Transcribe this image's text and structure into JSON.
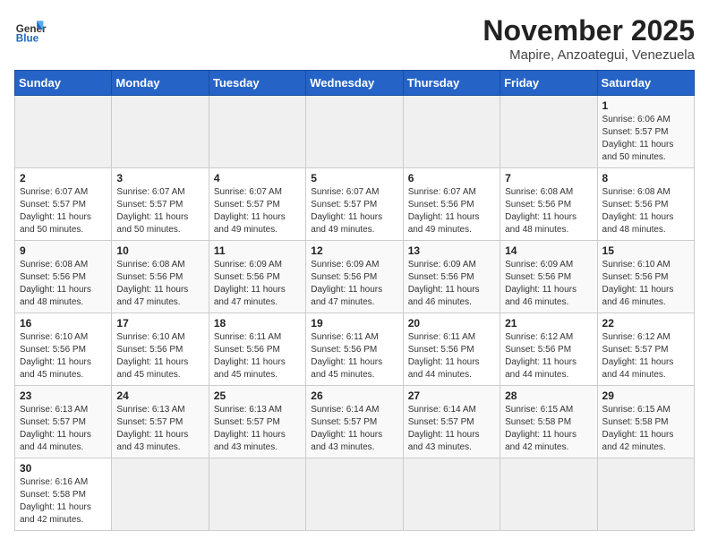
{
  "header": {
    "logo_general": "General",
    "logo_blue": "Blue",
    "month_title": "November 2025",
    "location": "Mapire, Anzoategui, Venezuela"
  },
  "weekdays": [
    "Sunday",
    "Monday",
    "Tuesday",
    "Wednesday",
    "Thursday",
    "Friday",
    "Saturday"
  ],
  "weeks": [
    [
      {
        "day": "",
        "info": ""
      },
      {
        "day": "",
        "info": ""
      },
      {
        "day": "",
        "info": ""
      },
      {
        "day": "",
        "info": ""
      },
      {
        "day": "",
        "info": ""
      },
      {
        "day": "",
        "info": ""
      },
      {
        "day": "1",
        "info": "Sunrise: 6:06 AM\nSunset: 5:57 PM\nDaylight: 11 hours\nand 50 minutes."
      }
    ],
    [
      {
        "day": "2",
        "info": "Sunrise: 6:07 AM\nSunset: 5:57 PM\nDaylight: 11 hours\nand 50 minutes."
      },
      {
        "day": "3",
        "info": "Sunrise: 6:07 AM\nSunset: 5:57 PM\nDaylight: 11 hours\nand 50 minutes."
      },
      {
        "day": "4",
        "info": "Sunrise: 6:07 AM\nSunset: 5:57 PM\nDaylight: 11 hours\nand 49 minutes."
      },
      {
        "day": "5",
        "info": "Sunrise: 6:07 AM\nSunset: 5:57 PM\nDaylight: 11 hours\nand 49 minutes."
      },
      {
        "day": "6",
        "info": "Sunrise: 6:07 AM\nSunset: 5:56 PM\nDaylight: 11 hours\nand 49 minutes."
      },
      {
        "day": "7",
        "info": "Sunrise: 6:08 AM\nSunset: 5:56 PM\nDaylight: 11 hours\nand 48 minutes."
      },
      {
        "day": "8",
        "info": "Sunrise: 6:08 AM\nSunset: 5:56 PM\nDaylight: 11 hours\nand 48 minutes."
      }
    ],
    [
      {
        "day": "9",
        "info": "Sunrise: 6:08 AM\nSunset: 5:56 PM\nDaylight: 11 hours\nand 48 minutes."
      },
      {
        "day": "10",
        "info": "Sunrise: 6:08 AM\nSunset: 5:56 PM\nDaylight: 11 hours\nand 47 minutes."
      },
      {
        "day": "11",
        "info": "Sunrise: 6:09 AM\nSunset: 5:56 PM\nDaylight: 11 hours\nand 47 minutes."
      },
      {
        "day": "12",
        "info": "Sunrise: 6:09 AM\nSunset: 5:56 PM\nDaylight: 11 hours\nand 47 minutes."
      },
      {
        "day": "13",
        "info": "Sunrise: 6:09 AM\nSunset: 5:56 PM\nDaylight: 11 hours\nand 46 minutes."
      },
      {
        "day": "14",
        "info": "Sunrise: 6:09 AM\nSunset: 5:56 PM\nDaylight: 11 hours\nand 46 minutes."
      },
      {
        "day": "15",
        "info": "Sunrise: 6:10 AM\nSunset: 5:56 PM\nDaylight: 11 hours\nand 46 minutes."
      }
    ],
    [
      {
        "day": "16",
        "info": "Sunrise: 6:10 AM\nSunset: 5:56 PM\nDaylight: 11 hours\nand 45 minutes."
      },
      {
        "day": "17",
        "info": "Sunrise: 6:10 AM\nSunset: 5:56 PM\nDaylight: 11 hours\nand 45 minutes."
      },
      {
        "day": "18",
        "info": "Sunrise: 6:11 AM\nSunset: 5:56 PM\nDaylight: 11 hours\nand 45 minutes."
      },
      {
        "day": "19",
        "info": "Sunrise: 6:11 AM\nSunset: 5:56 PM\nDaylight: 11 hours\nand 45 minutes."
      },
      {
        "day": "20",
        "info": "Sunrise: 6:11 AM\nSunset: 5:56 PM\nDaylight: 11 hours\nand 44 minutes."
      },
      {
        "day": "21",
        "info": "Sunrise: 6:12 AM\nSunset: 5:56 PM\nDaylight: 11 hours\nand 44 minutes."
      },
      {
        "day": "22",
        "info": "Sunrise: 6:12 AM\nSunset: 5:57 PM\nDaylight: 11 hours\nand 44 minutes."
      }
    ],
    [
      {
        "day": "23",
        "info": "Sunrise: 6:13 AM\nSunset: 5:57 PM\nDaylight: 11 hours\nand 44 minutes."
      },
      {
        "day": "24",
        "info": "Sunrise: 6:13 AM\nSunset: 5:57 PM\nDaylight: 11 hours\nand 43 minutes."
      },
      {
        "day": "25",
        "info": "Sunrise: 6:13 AM\nSunset: 5:57 PM\nDaylight: 11 hours\nand 43 minutes."
      },
      {
        "day": "26",
        "info": "Sunrise: 6:14 AM\nSunset: 5:57 PM\nDaylight: 11 hours\nand 43 minutes."
      },
      {
        "day": "27",
        "info": "Sunrise: 6:14 AM\nSunset: 5:57 PM\nDaylight: 11 hours\nand 43 minutes."
      },
      {
        "day": "28",
        "info": "Sunrise: 6:15 AM\nSunset: 5:58 PM\nDaylight: 11 hours\nand 42 minutes."
      },
      {
        "day": "29",
        "info": "Sunrise: 6:15 AM\nSunset: 5:58 PM\nDaylight: 11 hours\nand 42 minutes."
      }
    ],
    [
      {
        "day": "30",
        "info": "Sunrise: 6:16 AM\nSunset: 5:58 PM\nDaylight: 11 hours\nand 42 minutes."
      },
      {
        "day": "",
        "info": ""
      },
      {
        "day": "",
        "info": ""
      },
      {
        "day": "",
        "info": ""
      },
      {
        "day": "",
        "info": ""
      },
      {
        "day": "",
        "info": ""
      },
      {
        "day": "",
        "info": ""
      }
    ]
  ]
}
